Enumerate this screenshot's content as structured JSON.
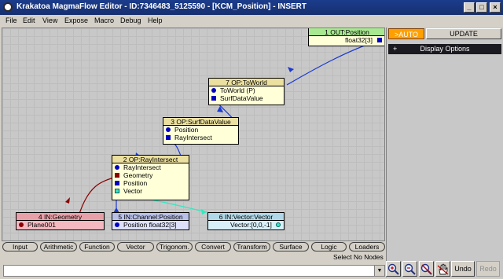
{
  "window": {
    "title": "Krakatoa MagmaFlow Editor - ID:7346483_5125590 - [KCM_Position] - INSERT",
    "minimize": "_",
    "maximize": "□",
    "close": "×"
  },
  "menu": [
    "File",
    "Edit",
    "View",
    "Expose",
    "Macro",
    "Debug",
    "Help"
  ],
  "nodes": {
    "out_position": {
      "header": "1 OUT:Position",
      "rows": [
        "float32[3]"
      ]
    },
    "toworld": {
      "header": "7 OP:ToWorld",
      "rows": [
        "ToWorld (P)",
        "SurfDataValue"
      ]
    },
    "surfdatavalue": {
      "header": "3 OP:SurfDataValue",
      "rows": [
        "Position",
        "RayIntersect"
      ]
    },
    "rayintersect": {
      "header": "2 OP:RayIntersect",
      "rows": [
        "RayIntersect",
        "Geometry",
        "Position",
        "Vector"
      ]
    },
    "geometry": {
      "header": "4 IN:Geometry",
      "rows": [
        "Plane001"
      ]
    },
    "channel_position": {
      "header": "5 IN:Channel:Position",
      "rows": [
        "Position float32[3]"
      ]
    },
    "vector": {
      "header": "6 IN:Vector:Vector",
      "rows": [
        "Vector:[0,0,-1]"
      ]
    }
  },
  "side_panel": {
    "auto_label": ">AUTO",
    "update_label": "UPDATE",
    "display_options_toggle": "+",
    "display_options_label": "Display Options"
  },
  "toolbar": [
    "Input",
    "Arithmetic",
    "Function",
    "Vector",
    "Trigonom.",
    "Convert",
    "Transform",
    "Surface",
    "Logic",
    "Loaders"
  ],
  "status": "Select No Nodes",
  "undo_label": "Undo",
  "redo_label": "Redo",
  "colors": {
    "titlebar": "#1b3c8c",
    "node_default": "#ffffd8",
    "node_geometry": "#f4b8c0",
    "node_geometry_header": "#e8a0a8",
    "node_channel": "#dde0f8",
    "node_channel_header": "#b8c0e8",
    "node_vector": "#d8f0f8",
    "node_vector_header": "#b0d8e8",
    "node_output_header": "#a8e890",
    "node_op_header": "#ece0a0",
    "wire_blue": "#1a3ad0",
    "wire_red": "#8b0000",
    "wire_cyan": "#30e8c0",
    "auto_button": "#ffa000"
  },
  "icons": [
    "zoom-in-icon",
    "zoom-out-icon",
    "zoom-reset-icon",
    "pan-hand-icon"
  ]
}
